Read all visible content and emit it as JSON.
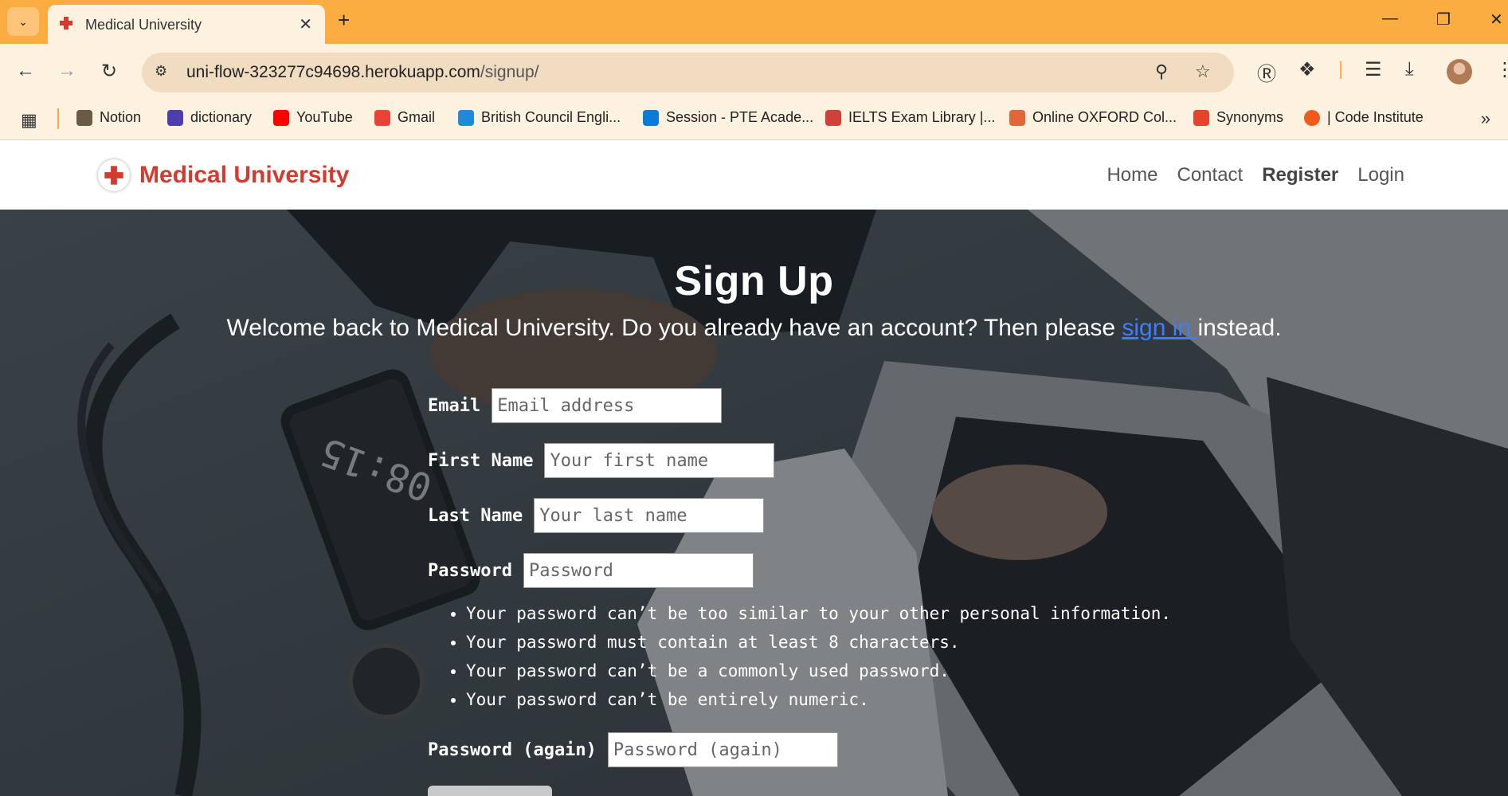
{
  "browser": {
    "tab_title": "Medical University",
    "url_domain": "uni-flow-323277c94698.herokuapp.com",
    "url_path": "/signup/",
    "bookmarks": [
      {
        "label": "Notion",
        "color": "#6b5a44"
      },
      {
        "label": "dictionary",
        "color": "#4b3fb0"
      },
      {
        "label": "YouTube",
        "color": "#ff0000"
      },
      {
        "label": "Gmail",
        "color": "#ea4335"
      },
      {
        "label": "British Council Engli...",
        "color": "#1e8ad8"
      },
      {
        "label": "Session - PTE Acade...",
        "color": "#0a7bd6"
      },
      {
        "label": "IELTS Exam Library |...",
        "color": "#d1413a"
      },
      {
        "label": "Online OXFORD Col...",
        "color": "#e0673a"
      },
      {
        "label": "Synonyms",
        "color": "#e2452b"
      },
      {
        "label": "| Code Institute",
        "color": "#f25a1d"
      }
    ]
  },
  "site": {
    "brand": "Medical University",
    "nav": {
      "home": "Home",
      "contact": "Contact",
      "register": "Register",
      "login": "Login"
    }
  },
  "signup": {
    "title": "Sign Up",
    "welcome_prefix": "Welcome back to Medical University. Do you already have an account? Then please ",
    "welcome_link": "sign in ",
    "welcome_suffix": "instead.",
    "fields": {
      "email_label": "Email",
      "email_placeholder": "Email address",
      "first_name_label": "First Name",
      "first_name_placeholder": "Your first name",
      "last_name_label": "Last Name",
      "last_name_placeholder": "Your last name",
      "password_label": "Password",
      "password_placeholder": "Password",
      "password2_label": "Password (again)",
      "password2_placeholder": "Password (again)"
    },
    "password_rules": [
      "Your password can’t be too similar to your other personal information.",
      "Your password must contain at least 8 characters.",
      "Your password can’t be a commonly used password.",
      "Your password can’t be entirely numeric."
    ],
    "phone_clock": "08:15"
  },
  "colors": {
    "tabbar": "#fcad42",
    "brand_red": "#d43b2f",
    "link_blue": "#3d7dff"
  }
}
